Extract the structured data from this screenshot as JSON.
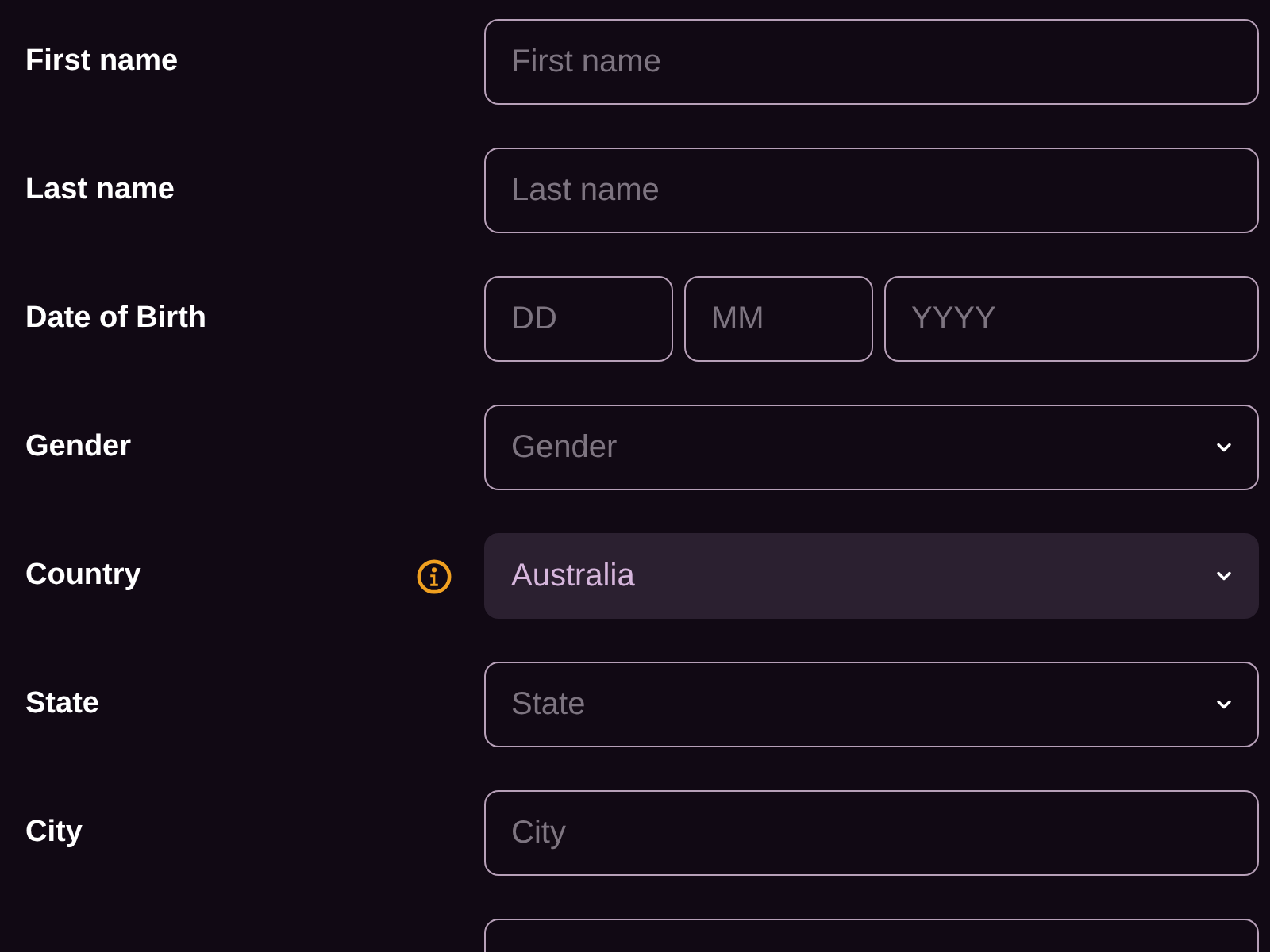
{
  "rows": [
    {
      "label": "First name",
      "kind": "text",
      "fields": [
        {
          "placeholder": "First name"
        }
      ]
    },
    {
      "label": "Last name",
      "kind": "text",
      "fields": [
        {
          "placeholder": "Last name"
        }
      ]
    },
    {
      "label": "Date of Birth",
      "kind": "date",
      "fields": [
        {
          "placeholder": "DD"
        },
        {
          "placeholder": "MM"
        },
        {
          "placeholder": "YYYY"
        }
      ]
    },
    {
      "label": "Gender",
      "kind": "select",
      "disabled": false,
      "fields": [
        {
          "placeholder": "Gender"
        }
      ]
    },
    {
      "label": "Country",
      "kind": "select",
      "info": true,
      "disabled": true,
      "fields": [
        {
          "value": "Australia"
        }
      ]
    },
    {
      "label": "State",
      "kind": "select",
      "disabled": false,
      "fields": [
        {
          "placeholder": "State"
        }
      ]
    },
    {
      "label": "City",
      "kind": "text",
      "fields": [
        {
          "placeholder": "City"
        }
      ]
    },
    {
      "kind": "text"
    }
  ]
}
